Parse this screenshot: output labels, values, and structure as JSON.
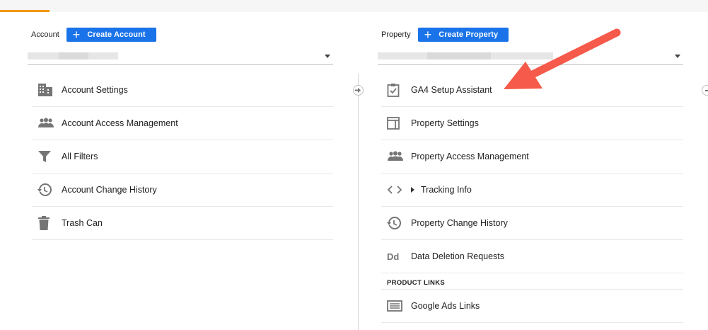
{
  "account": {
    "label": "Account",
    "create_button": "Create Account",
    "menu": [
      {
        "label": "Account Settings",
        "icon": "building-icon"
      },
      {
        "label": "Account Access Management",
        "icon": "people-icon"
      },
      {
        "label": "All Filters",
        "icon": "filter-icon"
      },
      {
        "label": "Account Change History",
        "icon": "history-icon"
      },
      {
        "label": "Trash Can",
        "icon": "trash-icon"
      }
    ]
  },
  "property": {
    "label": "Property",
    "create_button": "Create Property",
    "menu": [
      {
        "label": "GA4 Setup Assistant",
        "icon": "clipboard-check-icon"
      },
      {
        "label": "Property Settings",
        "icon": "layout-icon"
      },
      {
        "label": "Property Access Management",
        "icon": "people-icon"
      },
      {
        "label": "Tracking Info",
        "icon": "code-icon"
      },
      {
        "label": "Property Change History",
        "icon": "history-icon"
      },
      {
        "label": "Data Deletion Requests",
        "icon": "dd-icon"
      }
    ],
    "product_links_title": "PRODUCT LINKS",
    "product_links": [
      {
        "label": "Google Ads Links",
        "icon": "ads-links-icon"
      }
    ]
  },
  "colors": {
    "accent": "#1a73e8",
    "tab_underline": "#f29900",
    "annotation_arrow": "#f55a4a"
  },
  "icons": {
    "create_plus": "+",
    "dd_text": "Dd"
  }
}
